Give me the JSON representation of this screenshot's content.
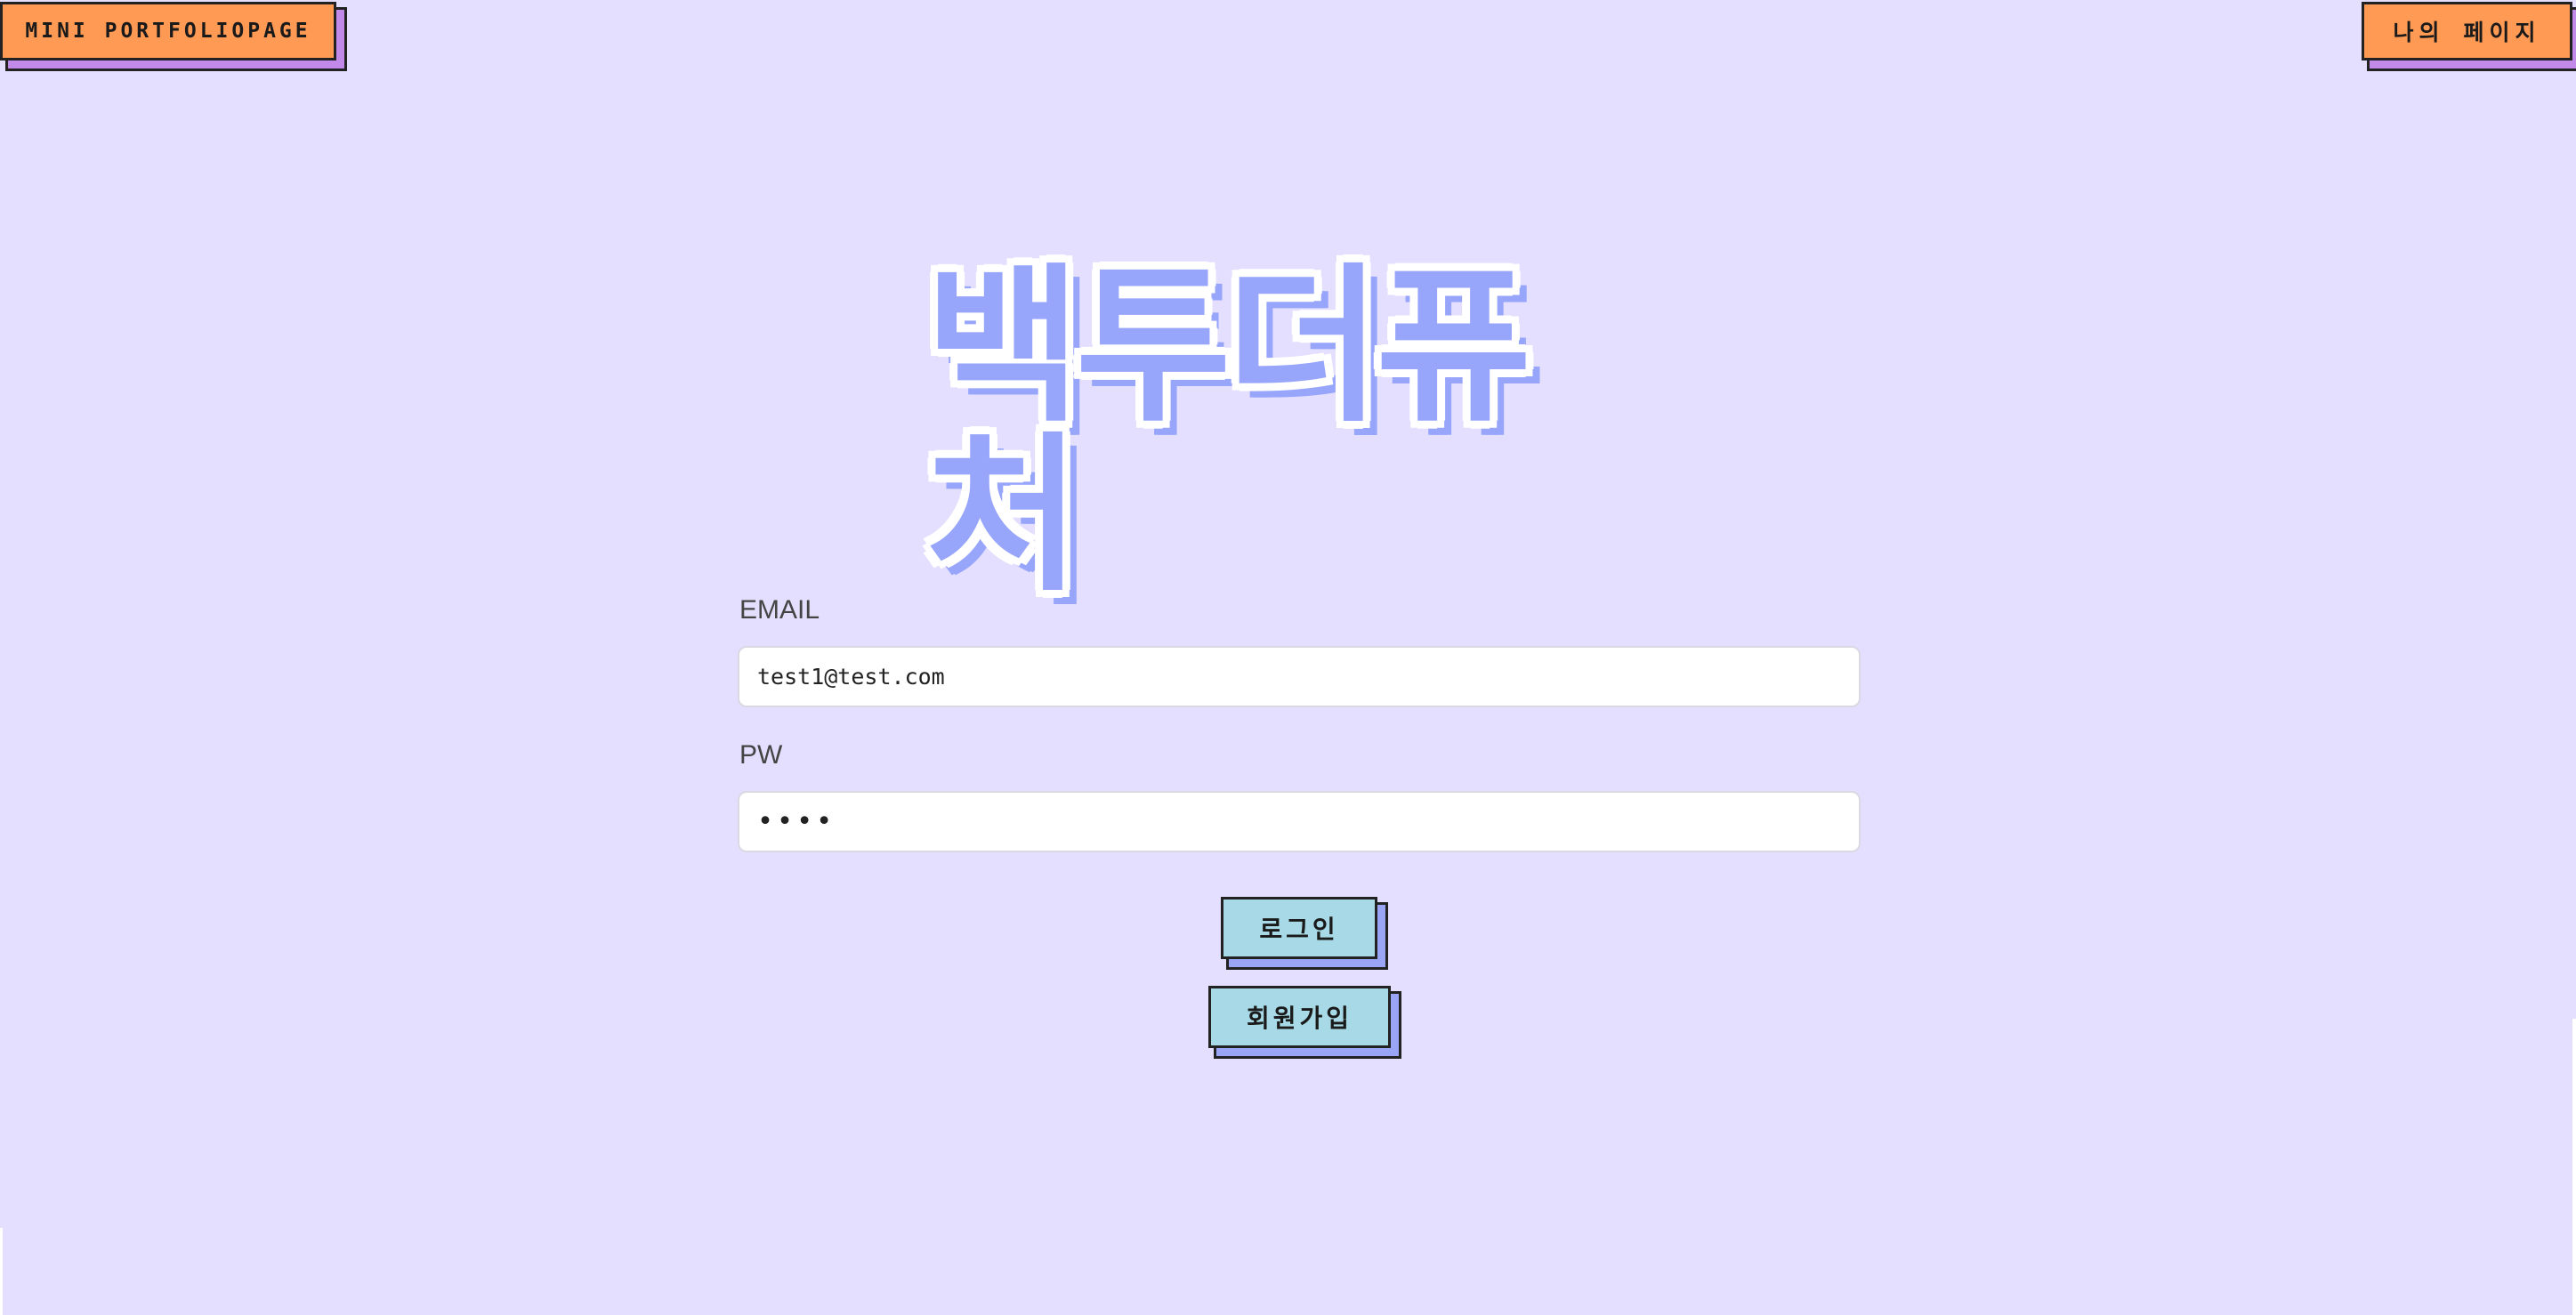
{
  "nav": {
    "home_label": "MINI PORTFOLIOPAGE",
    "mypage_label": "나의 페이지"
  },
  "logo": {
    "text": "백투더퓨처"
  },
  "form": {
    "email_label": "EMAIL",
    "email_value": "test1@test.com",
    "pw_label": "PW",
    "pw_value": "••••"
  },
  "actions": {
    "login_label": "로그인",
    "signup_label": "회원가입"
  },
  "colors": {
    "background": "#e4dffe",
    "nav_button": "#ff9a55",
    "nav_shadow": "#c18ae8",
    "action_button": "#a7dae6",
    "action_shadow": "#9aa5f5",
    "logo": "#97a5fb"
  }
}
